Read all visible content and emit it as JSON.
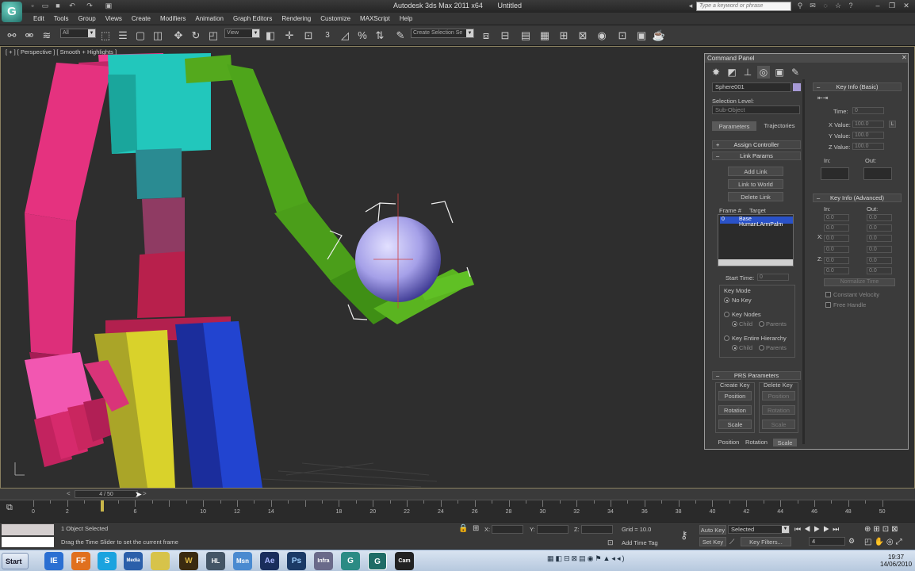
{
  "window": {
    "app_name": "Autodesk 3ds Max  2011 x64",
    "doc_name": "Untitled",
    "logo_glyph": "G",
    "search_placeholder": "Type a keyword or phrase"
  },
  "menu": [
    "Edit",
    "Tools",
    "Group",
    "Views",
    "Create",
    "Modifiers",
    "Animation",
    "Graph Editors",
    "Rendering",
    "Customize",
    "MAXScript",
    "Help"
  ],
  "toolbar": {
    "selection_filter": "All",
    "ref_coord": "View",
    "named_selection": "Create Selection Se",
    "snap_label": "3"
  },
  "viewport": {
    "label": "[ + ] [ Perspective ] [ Smooth + Highlights ]"
  },
  "command_panel": {
    "title": "Command Panel",
    "object_name": "Sphere001",
    "selection_level_label": "Selection Level:",
    "sub_object": "Sub-Object",
    "tab_parameters": "Parameters",
    "tab_trajectories": "Trajectories",
    "assign_controller": "Assign Controller",
    "link_params": "Link Params",
    "add_link": "Add Link",
    "link_to_world": "Link to World",
    "delete_link": "Delete Link",
    "frame_col": "Frame #",
    "target_col": "Target",
    "link_row_frame": "0",
    "link_row_target": "Base HumanLArmPalm",
    "start_time_label": "Start Time:",
    "start_time": "0",
    "key_mode": "Key Mode",
    "no_key": "No Key",
    "key_nodes": "Key Nodes",
    "child": "Child",
    "parents": "Parents",
    "key_entire": "Key Entire Hierarchy",
    "child2": "Child",
    "parents2": "Parents",
    "prs_params": "PRS Parameters",
    "create_key": "Create Key",
    "delete_key": "Delete Key",
    "position": "Position",
    "rotation": "Rotation",
    "scale": "Scale",
    "position_d": "Position",
    "rotation_d": "Rotation",
    "scale_d": "Scale",
    "bottom_position": "Position",
    "bottom_rotation": "Rotation",
    "bottom_scale": "Scale",
    "key_info_basic": "Key Info (Basic)",
    "time_label": "Time:",
    "time_val": "0",
    "x_value": "X Value:",
    "y_value": "Y Value:",
    "z_value": "Z Value:",
    "xv": "100.0",
    "yv": "100.0",
    "zv": "100.0",
    "lock": "L",
    "in_label": "In:",
    "out_label": "Out:",
    "key_info_adv": "Key Info (Advanced)",
    "adv_in": "In:",
    "adv_out": "Out:",
    "x_short": "X:",
    "y_short": "Y:",
    "z_short": "Z:",
    "adv_zero": "0.0",
    "normalize_time": "Normalize Time",
    "constant_velocity": "Constant Velocity",
    "free_handle": "Free Handle"
  },
  "timeline": {
    "slider": "4 / 50",
    "ticks": [
      "0",
      "2",
      "6",
      "10",
      "12",
      "14",
      "18",
      "20",
      "22",
      "24",
      "26",
      "28",
      "30",
      "32",
      "34",
      "36",
      "38",
      "40",
      "42",
      "44",
      "46",
      "48",
      "50"
    ]
  },
  "status": {
    "selected": "1 Object Selected",
    "prompt": "Drag the Time Slider to set the current frame",
    "x_label": "X:",
    "y_label": "Y:",
    "z_label": "Z:",
    "grid": "Grid = 10.0",
    "add_time_tag": "Add Time Tag",
    "auto_key": "Auto Key",
    "set_key": "Set Key",
    "key_select": "Selected",
    "key_filters": "Key Filters...",
    "frame": "4"
  },
  "taskbar": {
    "start": "Start",
    "time": "19:37",
    "date": "14/06/2010",
    "apps": [
      "IE",
      "FF",
      "S",
      "Media",
      "W",
      "HL",
      "Msn",
      "Ae",
      "Ps",
      "Infra",
      "G",
      "G",
      "Cam"
    ]
  },
  "colors": {
    "arm_left": "#e83382",
    "arm_green": "#4fa21a",
    "torso": "#1fc6bb",
    "yellow": "#d8cf2a",
    "blue": "#1e3ccc",
    "sphere": "#a7a3e9",
    "accent": "#a79ad6"
  }
}
